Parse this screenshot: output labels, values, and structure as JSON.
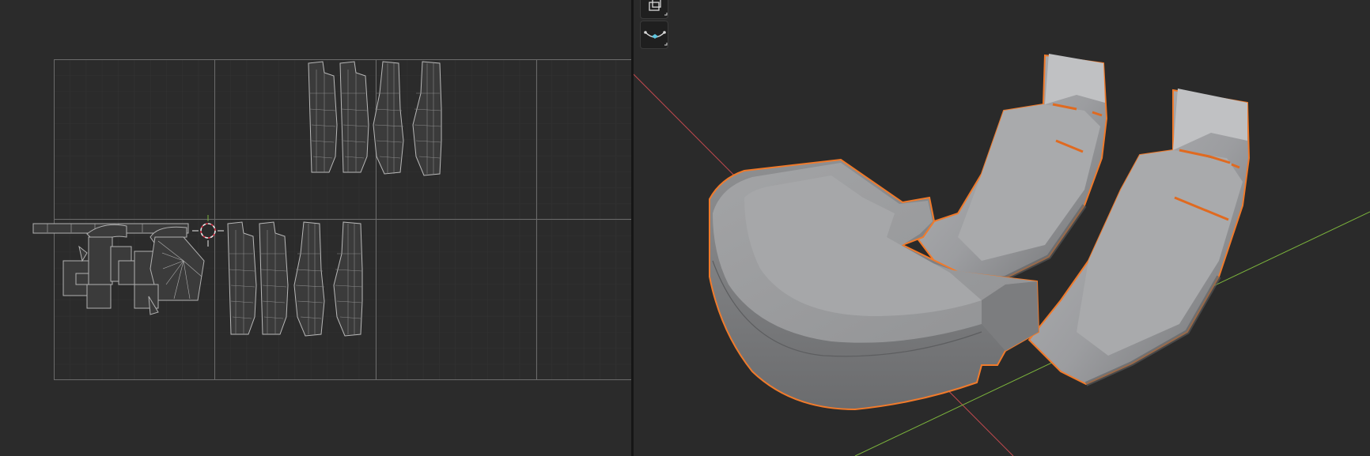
{
  "uv_editor": {
    "grid_color": "#3a3a3a",
    "tile_border_color": "#6b6b6b",
    "island_color": "#c7c7c7",
    "cursor_color": "#e8e8e8",
    "cursor_accent": "#e0384d"
  },
  "viewport": {
    "x_axis_color": "#c44a4f",
    "y_axis_color": "#7bb33c",
    "selection_outline_color": "#f07a2b",
    "mesh_color": "#9b9c9e",
    "tools": [
      {
        "name": "transform-tool-icon"
      },
      {
        "name": "curve-draw-tool-icon"
      }
    ]
  }
}
